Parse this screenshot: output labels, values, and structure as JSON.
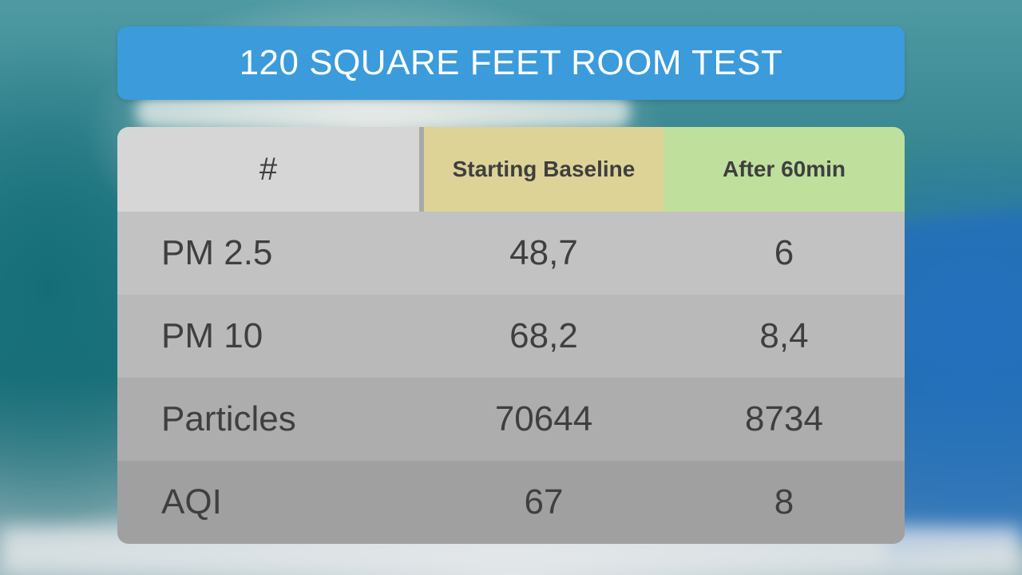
{
  "title": "120 SQUARE FEET ROOM TEST",
  "table": {
    "headers": [
      "#",
      "Starting Baseline",
      "After 60min"
    ],
    "header_colors": [
      "#d6d6d6",
      "#ddd396",
      "#bfdf9d"
    ],
    "rows": [
      {
        "metric": "PM 2.5",
        "baseline": "48,7",
        "after": "6"
      },
      {
        "metric": "PM 10",
        "baseline": "68,2",
        "after": "8,4"
      },
      {
        "metric": "Particles",
        "baseline": "70644",
        "after": "8734"
      },
      {
        "metric": "AQI",
        "baseline": "67",
        "after": "8"
      }
    ]
  },
  "colors": {
    "banner": "#3b9bdb",
    "text": "#3f3f3f"
  }
}
